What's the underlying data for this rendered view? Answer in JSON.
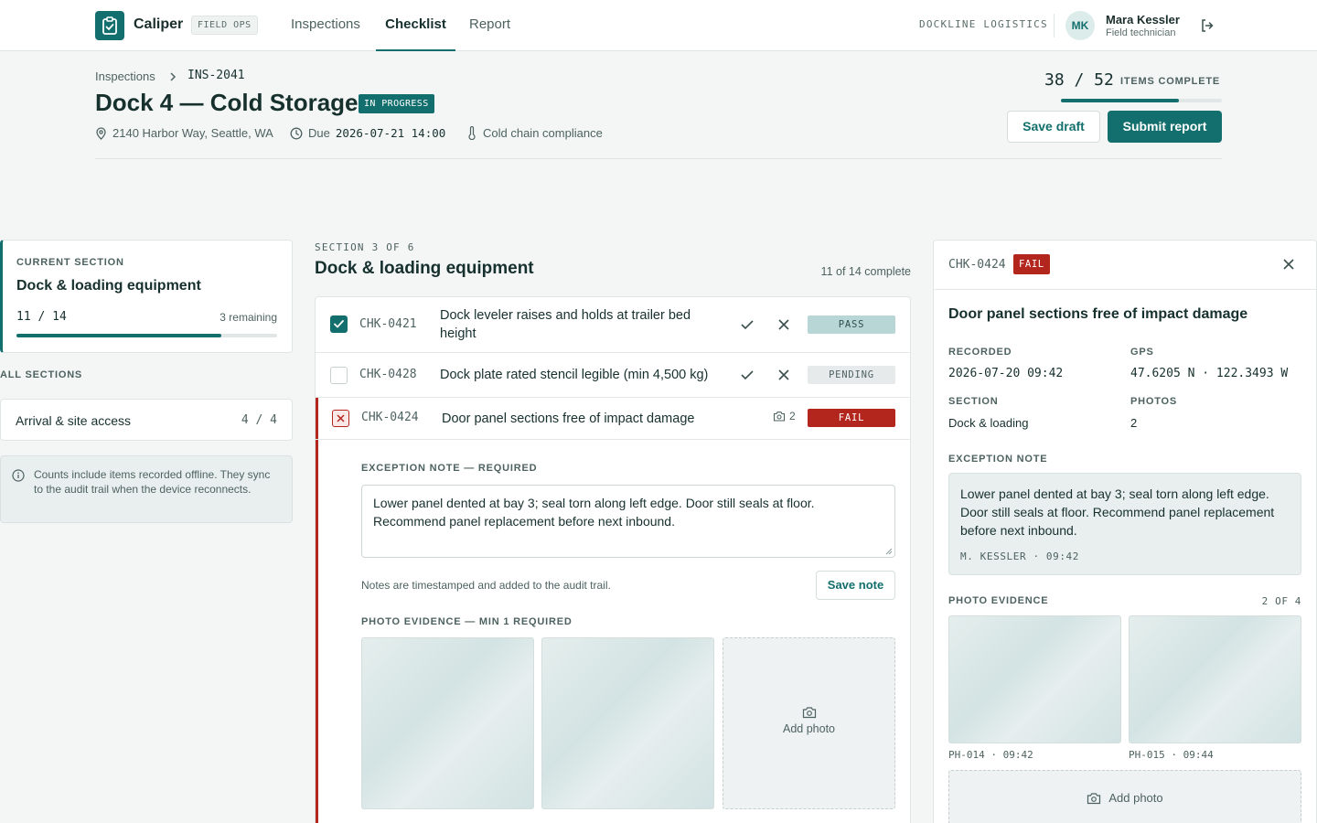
{
  "app": {
    "name": "Caliper",
    "tag": "FIELD OPS"
  },
  "nav": [
    {
      "label": "Inspections",
      "active": false
    },
    {
      "label": "Checklist",
      "active": true
    },
    {
      "label": "Report",
      "active": false
    }
  ],
  "org": "DOCKLINE LOGISTICS",
  "user": {
    "initials": "MK",
    "name": "Mara Kessler",
    "role": "Field technician"
  },
  "breadcrumb": {
    "parent": "Inspections",
    "current": "INS-2041"
  },
  "page": {
    "title": "Dock 4 — Cold Storage",
    "status": "IN PROGRESS",
    "address": "2140 Harbor Way, Seattle, WA",
    "due_label": "Due",
    "due_value": "2026-07-21 14:00",
    "category": "Cold chain compliance"
  },
  "progress": {
    "count": "38 / 52",
    "label": "ITEMS COMPLETE",
    "fraction": 0.731
  },
  "actions": {
    "save_draft": "Save draft",
    "submit": "Submit report"
  },
  "current_section": {
    "label": "CURRENT SECTION",
    "title": "Dock & loading equipment",
    "count": "11 / 14",
    "remaining": "3 remaining",
    "fraction": 0.786
  },
  "all_sections": {
    "label": "ALL SECTIONS",
    "items": [
      {
        "name": "Arrival & site access",
        "count": "4 / 4"
      }
    ]
  },
  "info": "Counts include items recorded offline. They sync to the audit trail when the device reconnects.",
  "section": {
    "kicker": "SECTION 3 OF 6",
    "title": "Dock & loading equipment",
    "complete": "11 of 14 complete"
  },
  "checklist": [
    {
      "id": "CHK-0421",
      "text": "Dock leveler raises and holds at trailer bed height",
      "status": "PASS"
    },
    {
      "id": "CHK-0428",
      "text": "Dock plate rated stencil legible (min 4,500 kg)",
      "status": "PENDING"
    },
    {
      "id": "CHK-0424",
      "text": "Door panel sections free of impact damage",
      "status": "FAIL",
      "photos": "2"
    }
  ],
  "expanded": {
    "exception_label": "EXCEPTION NOTE — REQUIRED",
    "note": "Lower panel dented at bay 3; seal torn along left edge. Door still seals at floor. Recommend panel replacement before next inbound.",
    "hint": "Notes are timestamped and added to the audit trail.",
    "save_note": "Save note",
    "photo_label": "PHOTO EVIDENCE — MIN 1 REQUIRED",
    "add_photo": "Add photo"
  },
  "detail": {
    "id": "CHK-0424",
    "status": "FAIL",
    "title": "Door panel sections free of impact damage",
    "recorded_label": "RECORDED",
    "recorded": "2026-07-20 09:42",
    "gps_label": "GPS",
    "gps": "47.6205 N · 122.3493 W",
    "section_label": "SECTION",
    "section": "Dock & loading",
    "photos_label": "PHOTOS",
    "photos": "2",
    "note_label": "EXCEPTION NOTE",
    "note": "Lower panel dented at bay 3; seal torn along left edge. Door still seals at floor. Recommend panel replacement before next inbound.",
    "note_by": "M. KESSLER · 09:42",
    "photo_label": "PHOTO EVIDENCE",
    "photo_count": "2 OF 4",
    "photo_captions": [
      "PH-014 · 09:42",
      "PH-015 · 09:44"
    ],
    "add_photo": "Add photo"
  },
  "colors": {
    "accent": "#136f6d",
    "fail": "#b3261e",
    "pass_badge": "#b9d6d6",
    "background": "#f4f6f6"
  },
  "icons": [
    "clipboard-check-icon",
    "chevron-right-icon",
    "map-pin-icon",
    "clock-icon",
    "thermometer-icon",
    "logout-icon",
    "check-icon",
    "x-icon",
    "camera-icon",
    "info-icon",
    "close-icon"
  ]
}
